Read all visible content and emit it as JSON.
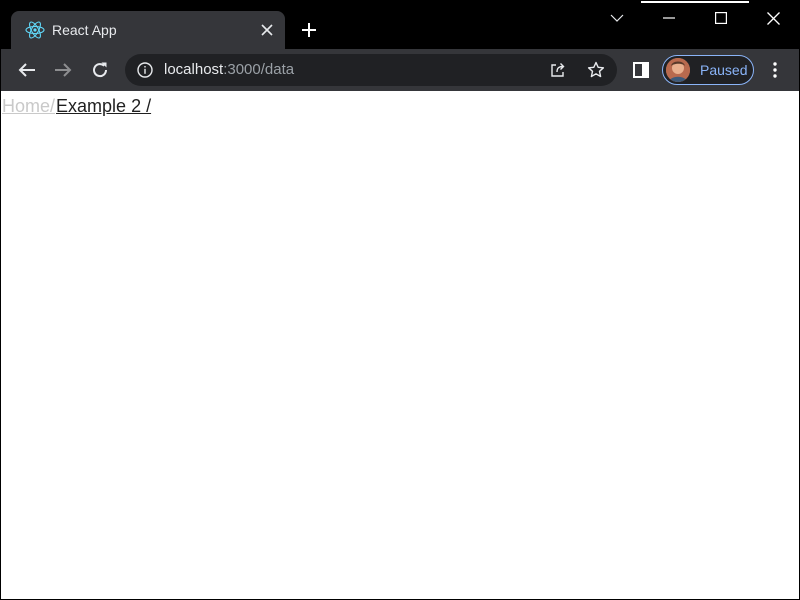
{
  "browser": {
    "tab": {
      "title": "React App",
      "favicon": "react-logo-icon"
    },
    "window_controls": [
      "tab-search-icon",
      "minimize-icon",
      "maximize-icon",
      "close-icon"
    ],
    "address_bar": {
      "host": "localhost",
      "rest": ":3000/data"
    },
    "profile": {
      "label": "Paused"
    },
    "colors": {
      "titlebar": "#000000",
      "toolbar": "#35363a",
      "omnibox": "#202124",
      "profile_accent": "#8ab4f8"
    }
  },
  "page": {
    "breadcrumb": {
      "home": "Home",
      "separator": "/",
      "current": "Example 2 /"
    }
  }
}
